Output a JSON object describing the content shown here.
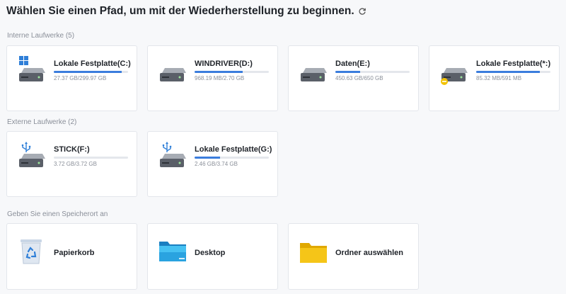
{
  "header": {
    "title": "Wählen Sie einen Pfad, um mit der Wiederherstellung zu beginnen."
  },
  "sections": {
    "internal": "Interne Laufwerke (5)",
    "external": "Externe Laufwerke (2)",
    "locations": "Geben Sie einen Speicherort an"
  },
  "internal_drives": [
    {
      "name": "Lokale Festplatte(C:)",
      "size": "27.37 GB/299.97 GB",
      "fill": 0.91,
      "badge": "windows-logo"
    },
    {
      "name": "WINDRIVER(D:)",
      "size": "968.19 MB/2.70 GB",
      "fill": 0.65,
      "badge": "none"
    },
    {
      "name": "Daten(E:)",
      "size": "450.63 GB/650 GB",
      "fill": 0.33,
      "badge": "none"
    },
    {
      "name": "Lokale Festplatte(*:)",
      "size": "85.32 MB/591 MB",
      "fill": 0.86,
      "badge": "warning"
    }
  ],
  "external_drives": [
    {
      "name": "STICK(F:)",
      "size": "3.72 GB/3.72 GB",
      "fill": 0.0,
      "badge": "usb"
    },
    {
      "name": "Lokale Festplatte(G:)",
      "size": "2.46 GB/3.74 GB",
      "fill": 0.34,
      "badge": "usb"
    }
  ],
  "locations": [
    {
      "name": "Papierkorb",
      "icon": "recycle-bin-icon"
    },
    {
      "name": "Desktop",
      "icon": "desktop-folder-icon"
    },
    {
      "name": "Ordner auswählen",
      "icon": "folder-icon"
    }
  ],
  "colors": {
    "accent": "#3b7ddd",
    "drive_body": "#5a5f68",
    "usb": "#2f7fd8",
    "folder": "#f5c518",
    "warning": "#f2c200"
  }
}
